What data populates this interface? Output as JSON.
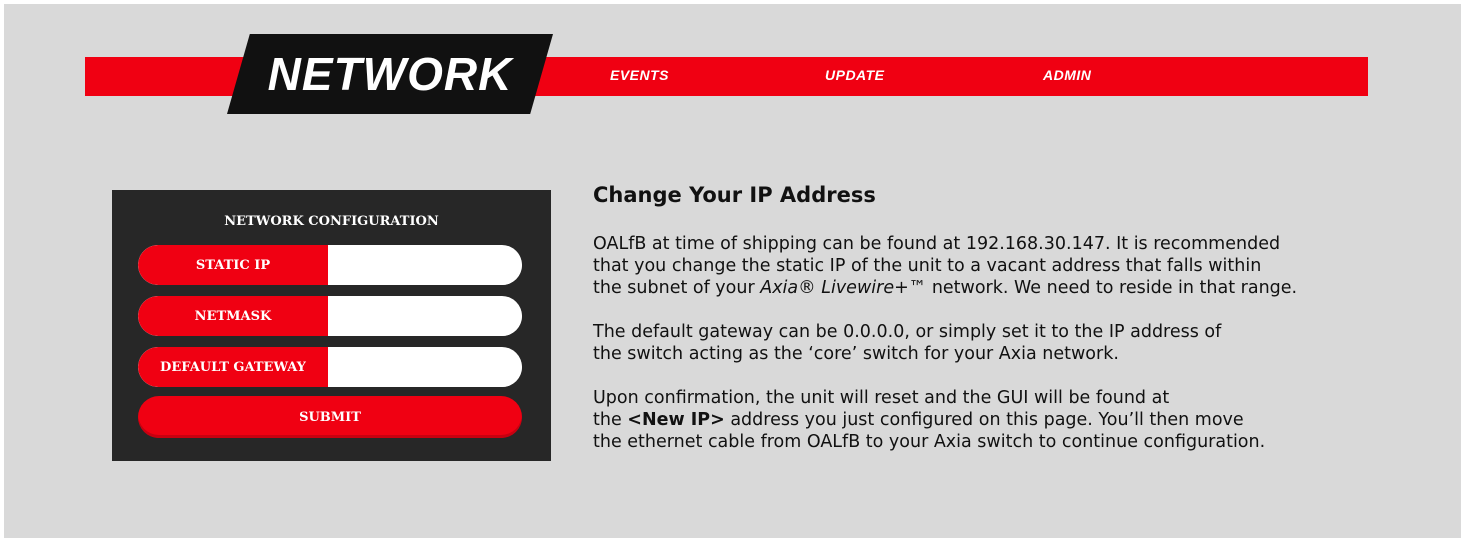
{
  "nav": {
    "active_tab": "NETWORK",
    "links": [
      "EVENTS",
      "UPDATE",
      "ADMIN"
    ],
    "accent_color": "#f00012"
  },
  "config_panel": {
    "title": "NETWORK CONFIGURATION",
    "fields": [
      {
        "label": "STATIC IP",
        "value": ""
      },
      {
        "label": "NETMASK",
        "value": ""
      },
      {
        "label": "DEFAULT GATEWAY",
        "value": ""
      }
    ],
    "submit_label": "SUBMIT"
  },
  "help": {
    "heading": "Change Your IP Address",
    "p1_line1": "OALfB at time of shipping can be found at 192.168.30.147.  It is recommended",
    "p1_line2": "that you change the static IP of the unit to a vacant address that falls within",
    "p1_line3_a": "the subnet of your ",
    "p1_line3_em": "Axia® Livewire+™",
    "p1_line3_b": " network.  We need to reside in that range.",
    "p2_line1": "The default gateway can be 0.0.0.0, or simply set it to the IP address of",
    "p2_line2": "the switch acting as the ‘core’ switch for your Axia network.",
    "p3_line1": "Upon confirmation, the unit will reset and the GUI will be found at",
    "p3_line2_a": "the ",
    "p3_line2_strong": "<New IP>",
    "p3_line2_b": " address you just configured on this page.  You’ll then move",
    "p3_line3": "the ethernet cable from OALfB to your Axia switch to continue configuration."
  }
}
